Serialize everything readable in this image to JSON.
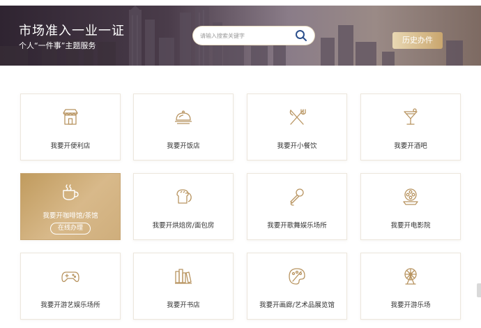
{
  "banner": {
    "title": "市场准入一业一证",
    "subtitle": "个人“一件事”主题服务",
    "search_placeholder": "请输入搜索关键字",
    "history_button": "历史办件"
  },
  "services": [
    {
      "label": "我要开便利店",
      "icon": "store-icon"
    },
    {
      "label": "我要开饭店",
      "icon": "restaurant-dish-icon"
    },
    {
      "label": "我要开小餐饮",
      "icon": "fork-knife-icon"
    },
    {
      "label": "我要开酒吧",
      "icon": "cocktail-icon"
    },
    {
      "label": "我要开咖啡馆/茶馆",
      "icon": "coffee-cup-icon",
      "action_label": "在线办理",
      "active": true
    },
    {
      "label": "我要开烘焙房/面包房",
      "icon": "bread-icon"
    },
    {
      "label": "我要开歌舞娱乐场所",
      "icon": "microphone-icon"
    },
    {
      "label": "我要开电影院",
      "icon": "film-reel-icon"
    },
    {
      "label": "我要开游艺娱乐场所",
      "icon": "gamepad-icon"
    },
    {
      "label": "我要开书店",
      "icon": "books-icon"
    },
    {
      "label": "我要开画廊/艺术品展览馆",
      "icon": "palette-icon"
    },
    {
      "label": "我要开游乐场",
      "icon": "ferris-wheel-icon"
    }
  ],
  "colors": {
    "accent": "#c9a66e",
    "icon_stroke": "#b89460",
    "active_card": "#c9a46b"
  }
}
